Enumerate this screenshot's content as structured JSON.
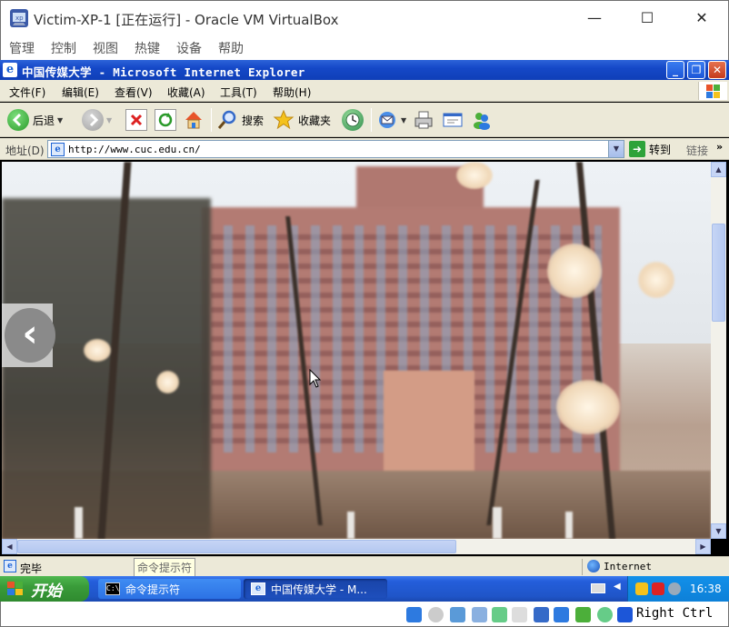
{
  "vbox": {
    "title": "Victim-XP-1 [正在运行] - Oracle VM VirtualBox",
    "menu": [
      "管理",
      "控制",
      "视图",
      "热键",
      "设备",
      "帮助"
    ],
    "controls": {
      "minimize": "—",
      "maximize": "☐",
      "close": "✕"
    },
    "host_key": "Right Ctrl"
  },
  "ie": {
    "title": "中国传媒大学 - Microsoft Internet Explorer",
    "title_icon": "e",
    "controls": {
      "minimize": "_",
      "restore": "❐",
      "close": "✕"
    },
    "menu": [
      "文件(F)",
      "编辑(E)",
      "查看(V)",
      "收藏(A)",
      "工具(T)",
      "帮助(H)"
    ],
    "toolbar": {
      "back_label": "后退",
      "search_label": "搜索",
      "favorites_label": "收藏夹"
    },
    "address": {
      "label": "地址(D)",
      "url": "http://www.cuc.edu.cn/",
      "go_label": "转到",
      "links_label": "链接",
      "links_chevron": "»"
    },
    "slider_prev_glyph": "‹",
    "status": {
      "text": "完毕",
      "tooltip": "命令提示符",
      "zone": "Internet"
    }
  },
  "taskbar": {
    "start_label": "开始",
    "tasks": [
      {
        "label": "命令提示符",
        "icon": "cmd-icon"
      },
      {
        "label": "中国传媒大学 - M...",
        "icon": "ie-icon"
      }
    ],
    "clock": "16:38"
  },
  "colors": {
    "xp_title_blue": "#1548c7",
    "xp_chrome": "#ece9d8",
    "start_green": "#3a9c3a",
    "taskbar_blue": "#245edb",
    "tray_blue": "#0d80d8"
  }
}
